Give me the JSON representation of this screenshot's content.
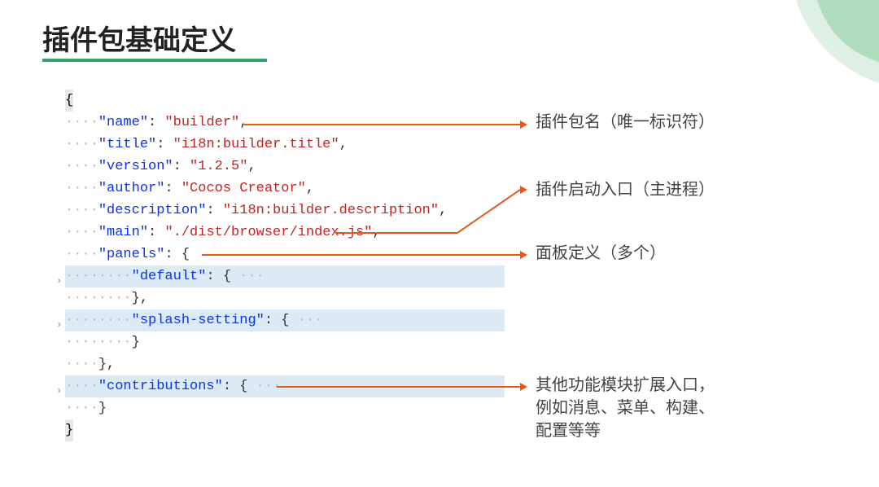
{
  "title": "插件包基础定义",
  "code": {
    "l0": "{",
    "d4": "····",
    "d8": "········",
    "k_name": "\"name\"",
    "v_name": "\"builder\"",
    "k_title": "\"title\"",
    "v_title": "\"i18n:builder.title\"",
    "k_version": "\"version\"",
    "v_version": "\"1.2.5\"",
    "k_author": "\"author\"",
    "v_author": "\"Cocos Creator\"",
    "k_description": "\"description\"",
    "v_description": "\"i18n:builder.description\"",
    "k_main": "\"main\"",
    "v_main": "\"./dist/browser/index.js\"",
    "k_panels": "\"panels\"",
    "k_default": "\"default\"",
    "k_splash": "\"splash-setting\"",
    "k_contrib": "\"contributions\"",
    "colon": ":",
    "colonsp": ": ",
    "comma": ",",
    "lbr": "{",
    "rbr": "}",
    "lbr_ell": "{ ···",
    "lbr_ell2": "{ ···",
    "close_brace_comma": "},",
    "rbr_close": "}"
  },
  "annotations": {
    "a1": "插件包名（唯一标识符）",
    "a2": "插件启动入口（主进程）",
    "a3": "面板定义（多个）",
    "a4": "其他功能模块扩展入口，\n例如消息、菜单、构建、\n配置等等"
  }
}
